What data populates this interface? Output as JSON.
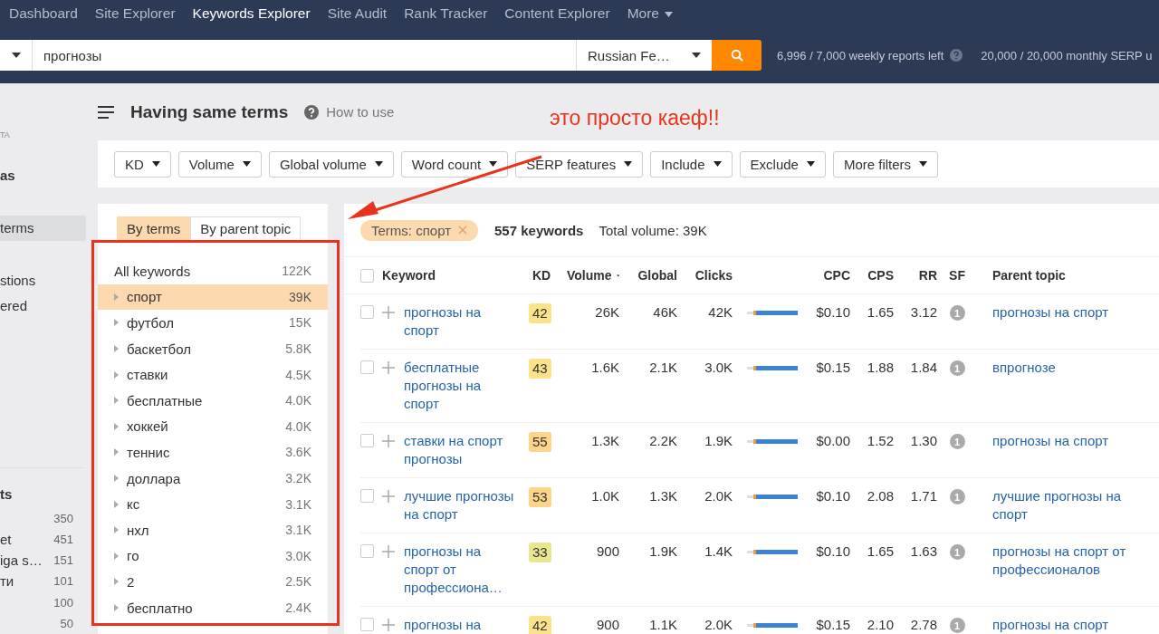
{
  "nav": {
    "items": [
      {
        "label": "Dashboard",
        "selected": false
      },
      {
        "label": "Site Explorer",
        "selected": false
      },
      {
        "label": "Keywords Explorer",
        "selected": true
      },
      {
        "label": "Site Audit",
        "selected": false
      },
      {
        "label": "Rank Tracker",
        "selected": false
      },
      {
        "label": "Content Explorer",
        "selected": false
      }
    ],
    "more": "More"
  },
  "search": {
    "value": "прогнозы",
    "country": "Russian Fe…",
    "quotas": [
      "6,996 / 7,000 weekly reports left",
      "20,000 / 20,000 monthly SERP u"
    ]
  },
  "sidebar": {
    "caption": "TA",
    "group_1": {
      "title": "as",
      "items": [
        {
          "label": "terms",
          "selected": true
        },
        {
          "label": "stions",
          "selected": false
        },
        {
          "label": "ered",
          "selected": false
        }
      ]
    },
    "group_2": {
      "title": "ts",
      "items": [
        {
          "count": "350"
        },
        {
          "label": "et",
          "count": "451"
        },
        {
          "label": "iga s…",
          "count": "151"
        },
        {
          "label": "ти",
          "count": "101"
        },
        {
          "count": "100"
        },
        {
          "count": "50"
        }
      ]
    }
  },
  "header": {
    "title": "Having same terms",
    "help": "How to use"
  },
  "filters": [
    "KD",
    "Volume",
    "Global volume",
    "Word count",
    "SERP features",
    "Include",
    "Exclude",
    "More filters"
  ],
  "terms_panel": {
    "tabs": [
      {
        "label": "By terms",
        "selected": true
      },
      {
        "label": "By parent topic",
        "selected": false
      }
    ],
    "all": {
      "label": "All keywords",
      "count": "122K"
    },
    "items": [
      {
        "label": "спорт",
        "count": "39K",
        "selected": true
      },
      {
        "label": "футбол",
        "count": "15K",
        "selected": false
      },
      {
        "label": "баскетбол",
        "count": "5.8K",
        "selected": false
      },
      {
        "label": "ставки",
        "count": "4.5K",
        "selected": false
      },
      {
        "label": "бесплатные",
        "count": "4.0K",
        "selected": false
      },
      {
        "label": "хоккей",
        "count": "4.0K",
        "selected": false
      },
      {
        "label": "теннис",
        "count": "3.6K",
        "selected": false
      },
      {
        "label": "доллара",
        "count": "3.2K",
        "selected": false
      },
      {
        "label": "кс",
        "count": "3.1K",
        "selected": false
      },
      {
        "label": "нхл",
        "count": "3.1K",
        "selected": false
      },
      {
        "label": "го",
        "count": "3.0K",
        "selected": false
      },
      {
        "label": "2",
        "count": "2.5K",
        "selected": false
      },
      {
        "label": "бесплатно",
        "count": "2.4K",
        "selected": false
      }
    ]
  },
  "table": {
    "chip": "Terms: спорт",
    "count": "557 keywords",
    "total": "Total volume: 39K",
    "select_all": {
      "checked": false
    },
    "columns": [
      "Keyword",
      "KD",
      "Volume",
      "Global",
      "Clicks",
      "CPC",
      "CPS",
      "RR",
      "SF",
      "Parent topic"
    ],
    "rows": [
      {
        "keyword": "прогнозы на спорт",
        "checked": false,
        "kd": {
          "value": "42",
          "color": "#fce38a"
        },
        "volume": "26K",
        "global": "46K",
        "clicks": "42K",
        "cpc": "$0.10",
        "cps": "1.65",
        "rr": "3.12",
        "sf": "1",
        "parent_topic": "прогнозы на спорт"
      },
      {
        "keyword": "бесплатные прогнозы на спорт",
        "checked": false,
        "kd": {
          "value": "43",
          "color": "#fce38a"
        },
        "volume": "1.6K",
        "global": "2.1K",
        "clicks": "3.0K",
        "cpc": "$0.15",
        "cps": "1.88",
        "rr": "1.84",
        "sf": "1",
        "parent_topic": "впрогнозе"
      },
      {
        "keyword": "ставки на спорт прогнозы",
        "checked": false,
        "kd": {
          "value": "55",
          "color": "#fdd588"
        },
        "volume": "1.3K",
        "global": "2.2K",
        "clicks": "1.9K",
        "cpc": "$0.00",
        "cps": "1.52",
        "rr": "1.30",
        "sf": "1",
        "parent_topic": "прогнозы на спорт"
      },
      {
        "keyword": "лучшие прогнозы на спорт",
        "checked": false,
        "kd": {
          "value": "53",
          "color": "#fdd588"
        },
        "volume": "1.0K",
        "global": "1.3K",
        "clicks": "2.0K",
        "cpc": "$0.10",
        "cps": "2.08",
        "rr": "1.71",
        "sf": "1",
        "parent_topic": "лучшие прогнозы на спорт"
      },
      {
        "keyword": "прогнозы на спорт от профессиона…",
        "checked": false,
        "kd": {
          "value": "33",
          "color": "#e8e78f"
        },
        "volume": "900",
        "global": "1.9K",
        "clicks": "1.4K",
        "cpc": "$0.10",
        "cps": "1.65",
        "rr": "1.63",
        "sf": "1",
        "parent_topic": "прогнозы на спорт от профессионалов"
      },
      {
        "keyword": "прогнозы на",
        "checked": false,
        "kd": {
          "value": "42",
          "color": "#fce38a"
        },
        "volume": "900",
        "global": "1.1K",
        "clicks": "2.0K",
        "cpc": "$0.15",
        "cps": "2.10",
        "rr": "2.78",
        "sf": "1",
        "parent_topic": "прогнозы на спорт"
      }
    ]
  },
  "annotation": {
    "text": "это просто каеф!!"
  }
}
